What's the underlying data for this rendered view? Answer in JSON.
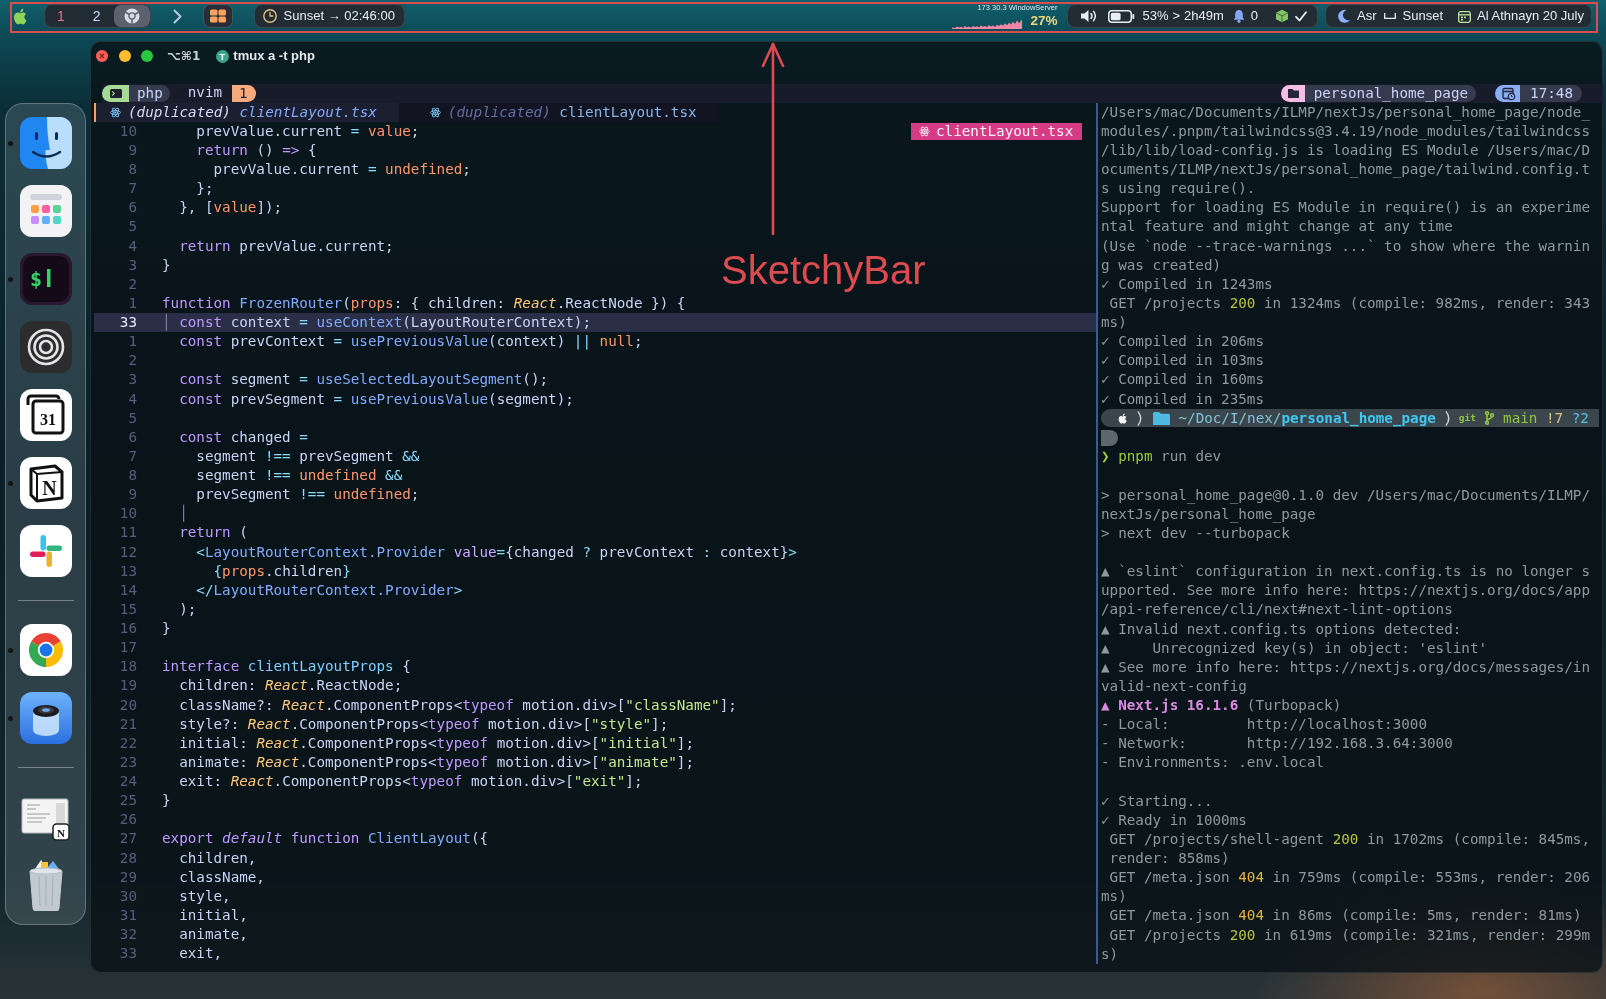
{
  "menu_bar": {
    "spaces": [
      {
        "label": "1",
        "selected": true
      },
      {
        "label": "2",
        "selected": false
      }
    ],
    "countdown": "Sunset → 02:46:00",
    "cpu": {
      "caption": "173 30.3 WindowServer",
      "percent": "27%"
    },
    "battery": {
      "percent": "53%",
      "separator": ">",
      "remaining": "2h49m"
    },
    "notifications": "0",
    "prayer": {
      "current": "Asr",
      "next": "Sunset"
    },
    "date": "Al Athnayn 20 July"
  },
  "annotation": {
    "label": "SketchyBar"
  },
  "dock": {
    "sections": [
      [
        {
          "kind": "finder",
          "running": true
        },
        {
          "kind": "launchpad",
          "running": false
        },
        {
          "kind": "terminal",
          "glyph": "$",
          "running": true
        },
        {
          "kind": "rings",
          "running": false
        },
        {
          "kind": "calendar",
          "glyph": "31",
          "running": false
        },
        {
          "kind": "notion",
          "glyph": "N",
          "running": true
        },
        {
          "kind": "slack",
          "running": false
        }
      ],
      [
        {
          "kind": "chrome",
          "running": true
        },
        {
          "kind": "lens",
          "running": true
        }
      ],
      [
        {
          "kind": "document",
          "glyph": "N",
          "running": false
        },
        {
          "kind": "trash",
          "running": false
        }
      ]
    ]
  },
  "window": {
    "shortcut": "⌥⌘1",
    "badge": "T",
    "title": "tmux a -t php"
  },
  "tmux": {
    "session": "php",
    "windows": [
      {
        "name": "nvim",
        "index": "1",
        "selected": true
      }
    ],
    "directory": "personal_home_page",
    "time": "17:48"
  },
  "editor": {
    "buffers": [
      {
        "prefix": "(duplicated)",
        "name": "clientLayout.tsx",
        "selected": true
      },
      {
        "prefix": "(duplicated)",
        "name": "clientLayout.tsx",
        "selected": false
      }
    ],
    "filename_badge": "clientLayout.tsx",
    "lines": [
      {
        "n": "10",
        "current": false,
        "code": [
          "    prevValue.current ",
          {
            "kind": "op",
            "text": "="
          },
          {
            "kind": "param",
            "text": " value"
          },
          ";"
        ]
      },
      {
        "n": "9",
        "current": false,
        "code": [
          {
            "kind": "key",
            "text": "    return"
          },
          " () ",
          {
            "kind": "key",
            "text": "=>"
          },
          " {"
        ]
      },
      {
        "n": "8",
        "current": false,
        "code": [
          "      prevValue.current ",
          {
            "kind": "op",
            "text": "="
          },
          {
            "kind": "const",
            "text": " undefined"
          },
          ";"
        ]
      },
      {
        "n": "7",
        "current": false,
        "code": "    };"
      },
      {
        "n": "6",
        "current": false,
        "code": [
          "  }, [",
          {
            "kind": "param",
            "text": "value"
          },
          "]);"
        ]
      },
      {
        "n": "5",
        "current": false
      },
      {
        "n": "4",
        "current": false,
        "code": [
          {
            "kind": "key",
            "text": "  return"
          },
          " prevValue.current;"
        ]
      },
      {
        "n": "3",
        "current": false,
        "code": "}"
      },
      {
        "n": "2",
        "current": false
      },
      {
        "n": "1",
        "current": false,
        "code": [
          {
            "kind": "key",
            "text": "function"
          },
          {
            "kind": "fn",
            "text": " FrozenRouter"
          },
          "(",
          {
            "kind": "param",
            "text": "props"
          },
          ": { children: ",
          {
            "kind": "ns",
            "text": "React"
          },
          ".ReactNode }) {"
        ]
      },
      {
        "n": "33",
        "current": true,
        "code": [
          {
            "kind": "guide",
            "text": "│"
          },
          {
            "kind": "key",
            "text": " const"
          },
          " context ",
          {
            "kind": "op",
            "text": "="
          },
          {
            "kind": "fn",
            "text": " useContext"
          },
          "(LayoutRouterContext);"
        ]
      },
      {
        "n": "1",
        "current": false,
        "code": [
          {
            "kind": "key",
            "text": "  const"
          },
          " prevContext ",
          {
            "kind": "op",
            "text": "="
          },
          {
            "kind": "fn",
            "text": " usePreviousValue"
          },
          "(context) ",
          {
            "kind": "op",
            "text": "||"
          },
          {
            "kind": "const",
            "text": " null"
          },
          ";"
        ]
      },
      {
        "n": "2",
        "current": false
      },
      {
        "n": "3",
        "current": false,
        "code": [
          {
            "kind": "key",
            "text": "  const"
          },
          " segment ",
          {
            "kind": "op",
            "text": "="
          },
          {
            "kind": "fn",
            "text": " useSelectedLayoutSegment"
          },
          "();"
        ]
      },
      {
        "n": "4",
        "current": false,
        "code": [
          {
            "kind": "key",
            "text": "  const"
          },
          " prevSegment ",
          {
            "kind": "op",
            "text": "="
          },
          {
            "kind": "fn",
            "text": " usePreviousValue"
          },
          "(segment);"
        ]
      },
      {
        "n": "5",
        "current": false
      },
      {
        "n": "6",
        "current": false,
        "code": [
          {
            "kind": "key",
            "text": "  const"
          },
          " changed ",
          {
            "kind": "op",
            "text": "="
          }
        ]
      },
      {
        "n": "7",
        "current": false,
        "code": [
          "    segment ",
          {
            "kind": "op",
            "text": "!=="
          },
          " prevSegment ",
          {
            "kind": "op",
            "text": "&&"
          }
        ]
      },
      {
        "n": "8",
        "current": false,
        "code": [
          "    segment ",
          {
            "kind": "op",
            "text": "!=="
          },
          {
            "kind": "const",
            "text": " undefined"
          },
          {
            "kind": "op",
            "text": " &&"
          }
        ]
      },
      {
        "n": "9",
        "current": false,
        "code": [
          "    prevSegment ",
          {
            "kind": "op",
            "text": "!=="
          },
          {
            "kind": "const",
            "text": " undefined"
          },
          ";"
        ]
      },
      {
        "n": "10",
        "current": false,
        "code": [
          {
            "kind": "guide",
            "text": "  │"
          }
        ]
      },
      {
        "n": "11",
        "current": false,
        "code": [
          {
            "kind": "key",
            "text": "  return"
          },
          " ("
        ]
      },
      {
        "n": "12",
        "current": false,
        "code": [
          {
            "kind": "op",
            "text": "    <"
          },
          {
            "kind": "fn",
            "text": "LayoutRouterContext.Provider"
          },
          {
            "kind": "attr",
            "text": " value"
          },
          {
            "kind": "op",
            "text": "="
          },
          "{changed ",
          {
            "kind": "op",
            "text": "?"
          },
          " prevContext ",
          {
            "kind": "op",
            "text": ":"
          },
          " context}",
          {
            "kind": "op",
            "text": ">"
          }
        ]
      },
      {
        "n": "13",
        "current": false,
        "code": [
          {
            "kind": "op",
            "text": "      {"
          },
          {
            "kind": "param",
            "text": "props"
          },
          ".children",
          {
            "kind": "op",
            "text": "}"
          }
        ]
      },
      {
        "n": "14",
        "current": false,
        "code": [
          {
            "kind": "op",
            "text": "    </"
          },
          {
            "kind": "fn",
            "text": "LayoutRouterContext.Provider"
          },
          {
            "kind": "op",
            "text": ">"
          }
        ]
      },
      {
        "n": "15",
        "current": false,
        "code": "  );"
      },
      {
        "n": "16",
        "current": false,
        "code": "}"
      },
      {
        "n": "17",
        "current": false
      },
      {
        "n": "18",
        "current": false,
        "code": [
          {
            "kind": "key",
            "text": "interface"
          },
          {
            "kind": "type",
            "text": " clientLayoutProps"
          },
          " {"
        ]
      },
      {
        "n": "19",
        "current": false,
        "code": [
          "  children: ",
          {
            "kind": "ns",
            "text": "React"
          },
          ".ReactNode;"
        ]
      },
      {
        "n": "20",
        "current": false,
        "code": [
          "  className?: ",
          {
            "kind": "ns",
            "text": "React"
          },
          ".ComponentProps<",
          {
            "kind": "key",
            "text": "typeof"
          },
          " motion.div>[",
          {
            "kind": "str",
            "text": "\"className\""
          },
          "];"
        ]
      },
      {
        "n": "21",
        "current": false,
        "code": [
          "  style?: ",
          {
            "kind": "ns",
            "text": "React"
          },
          ".ComponentProps<",
          {
            "kind": "key",
            "text": "typeof"
          },
          " motion.div>[",
          {
            "kind": "str",
            "text": "\"style\""
          },
          "];"
        ]
      },
      {
        "n": "22",
        "current": false,
        "code": [
          "  initial: ",
          {
            "kind": "ns",
            "text": "React"
          },
          ".ComponentProps<",
          {
            "kind": "key",
            "text": "typeof"
          },
          " motion.div>[",
          {
            "kind": "str",
            "text": "\"initial\""
          },
          "];"
        ]
      },
      {
        "n": "23",
        "current": false,
        "code": [
          "  animate: ",
          {
            "kind": "ns",
            "text": "React"
          },
          ".ComponentProps<",
          {
            "kind": "key",
            "text": "typeof"
          },
          " motion.div>[",
          {
            "kind": "str",
            "text": "\"animate\""
          },
          "];"
        ]
      },
      {
        "n": "24",
        "current": false,
        "code": [
          "  exit: ",
          {
            "kind": "ns",
            "text": "React"
          },
          ".ComponentProps<",
          {
            "kind": "key",
            "text": "typeof"
          },
          " motion.div>[",
          {
            "kind": "str",
            "text": "\"exit\""
          },
          "];"
        ]
      },
      {
        "n": "25",
        "current": false,
        "code": "}"
      },
      {
        "n": "26",
        "current": false
      },
      {
        "n": "27",
        "current": false,
        "code": [
          {
            "kind": "key",
            "text": "export"
          },
          {
            "kind": "mod",
            "text": " default"
          },
          {
            "kind": "key",
            "text": " function"
          },
          {
            "kind": "fn",
            "text": " ClientLayout"
          },
          "({"
        ]
      },
      {
        "n": "28",
        "current": false,
        "code": "  children,"
      },
      {
        "n": "29",
        "current": false,
        "code": "  className,"
      },
      {
        "n": "30",
        "current": false,
        "code": "  style,"
      },
      {
        "n": "31",
        "current": false,
        "code": "  initial,"
      },
      {
        "n": "32",
        "current": false,
        "code": "  animate,"
      },
      {
        "n": "33",
        "current": false,
        "code": "  exit,"
      }
    ]
  },
  "terminal": {
    "lines": [
      {
        "kind": "output",
        "rows": [
          "/Users/mac/Documents/ILMP/nextJs/personal_home_page/node_",
          "modules/.pnpm/tailwindcss@3.4.19/node_modules/tailwindcss",
          "/lib/lib/load-config.js is loading ES Module /Users/mac/D",
          "ocuments/ILMP/nextJs/personal_home_page/tailwind.config.t",
          "s using require()."
        ]
      },
      {
        "kind": "output",
        "rows": [
          "Support for loading ES Module in require() is an experime",
          "ntal feature and might change at any time"
        ]
      },
      {
        "kind": "output",
        "rows": [
          "(Use `node --trace-warnings ...` to show where the warnin",
          "g was created)"
        ]
      },
      {
        "kind": "output",
        "rows": [
          "✓ Compiled in 1243ms"
        ]
      },
      {
        "kind": "output",
        "rows": [
          [
            " GET /projects ",
            {
              "kind": "ok",
              "text": "200"
            },
            " in 1324ms (compile: 982ms, render: 343"
          ],
          "ms)"
        ]
      },
      {
        "kind": "output",
        "rows": [
          "✓ Compiled in 206ms"
        ]
      },
      {
        "kind": "output",
        "rows": [
          "✓ Compiled in 103ms"
        ]
      },
      {
        "kind": "output",
        "rows": [
          "✓ Compiled in 160ms"
        ]
      },
      {
        "kind": "output",
        "rows": [
          "✓ Compiled in 235ms"
        ]
      },
      {
        "kind": "prompt",
        "path_parent": "~/Doc/I/nex/",
        "path_dir": "personal_home_page",
        "vcs": "git",
        "branch": "main",
        "modified": "!7",
        "untracked": "?2"
      },
      {
        "kind": "continuation"
      },
      {
        "kind": "command",
        "symbol": "❯",
        "command": [
          {
            "kind": "cmd",
            "text": "pnpm"
          },
          " run dev"
        ]
      },
      {
        "kind": "blank"
      },
      {
        "kind": "output",
        "rows": [
          "> personal_home_page@0.1.0 dev /Users/mac/Documents/ILMP/",
          "nextJs/personal_home_page"
        ]
      },
      {
        "kind": "output",
        "rows": [
          "> next dev --turbopack"
        ]
      },
      {
        "kind": "blank"
      },
      {
        "kind": "output",
        "rows": [
          "▲ `eslint` configuration in next.config.ts is no longer s",
          "upported. See more info here: https://nextjs.org/docs/app",
          "/api-reference/cli/next#next-lint-options"
        ]
      },
      {
        "kind": "output",
        "rows": [
          "▲ Invalid next.config.ts options detected:"
        ]
      },
      {
        "kind": "output",
        "rows": [
          "▲     Unrecognized key(s) in object: 'eslint'"
        ]
      },
      {
        "kind": "output",
        "rows": [
          "▲ See more info here: https://nextjs.org/docs/messages/in",
          "valid-next-config"
        ]
      },
      {
        "kind": "output",
        "rows": [
          [
            {
              "kind": "brand",
              "text": "▲ Next.js 16.1.6"
            },
            " (Turbopack)"
          ]
        ]
      },
      {
        "kind": "output",
        "rows": [
          "- Local:         http://localhost:3000"
        ]
      },
      {
        "kind": "output",
        "rows": [
          "- Network:       http://192.168.3.64:3000"
        ]
      },
      {
        "kind": "output",
        "rows": [
          "- Environments: .env.local"
        ]
      },
      {
        "kind": "blank"
      },
      {
        "kind": "output",
        "rows": [
          "✓ Starting..."
        ]
      },
      {
        "kind": "output",
        "rows": [
          "✓ Ready in 1000ms"
        ]
      },
      {
        "kind": "output",
        "rows": [
          [
            " GET /projects/shell-agent ",
            {
              "kind": "ok",
              "text": "200"
            },
            " in 1702ms (compile: 845ms,"
          ],
          " render: 858ms)"
        ]
      },
      {
        "kind": "output",
        "rows": [
          [
            " GET /meta.json ",
            {
              "kind": "warn",
              "text": "404"
            },
            " in 759ms (compile: 553ms, render: 206"
          ],
          "ms)"
        ]
      },
      {
        "kind": "output",
        "rows": [
          [
            " GET /meta.json ",
            {
              "kind": "warn",
              "text": "404"
            },
            " in 86ms (compile: 5ms, render: 81ms)"
          ]
        ]
      },
      {
        "kind": "output",
        "rows": [
          [
            " GET /projects ",
            {
              "kind": "ok",
              "text": "200"
            },
            " in 619ms (compile: 321ms, render: 299m"
          ],
          "s)"
        ]
      }
    ]
  }
}
